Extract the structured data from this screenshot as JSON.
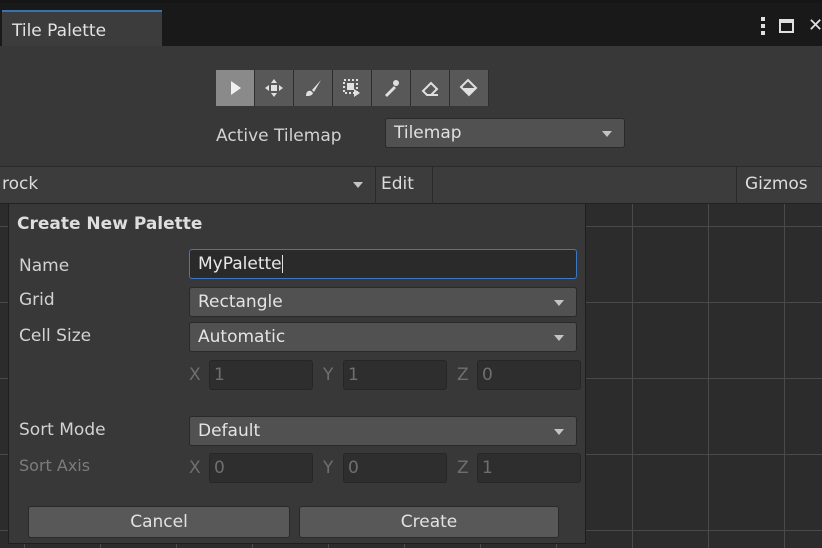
{
  "window": {
    "tab_title": "Tile Palette"
  },
  "toolbar": {
    "tools": [
      {
        "name": "select-tool",
        "icon": "arrow-pointer-icon",
        "active": true
      },
      {
        "name": "move-tool",
        "icon": "move-arrows-icon",
        "active": false
      },
      {
        "name": "paint-tool",
        "icon": "brush-icon",
        "active": false
      },
      {
        "name": "box-fill-tool",
        "icon": "box-fill-icon",
        "active": false
      },
      {
        "name": "picker-tool",
        "icon": "eyedropper-icon",
        "active": false
      },
      {
        "name": "erase-tool",
        "icon": "eraser-icon",
        "active": false
      },
      {
        "name": "fill-tool",
        "icon": "paint-bucket-icon",
        "active": false
      }
    ],
    "active_tilemap_label": "Active Tilemap",
    "active_tilemap_value": "Tilemap"
  },
  "palette_bar": {
    "palette_value": "rock",
    "edit_label": "Edit",
    "gizmos_label": "Gizmos"
  },
  "create_palette": {
    "title": "Create New Palette",
    "name_label": "Name",
    "name_value": "MyPalette",
    "grid_label": "Grid",
    "grid_value": "Rectangle",
    "cell_size_label": "Cell Size",
    "cell_size_value": "Automatic",
    "cell_size_vector": {
      "x_label": "X",
      "x": "1",
      "y_label": "Y",
      "y": "1",
      "z_label": "Z",
      "z": "0"
    },
    "sort_mode_label": "Sort Mode",
    "sort_mode_value": "Default",
    "sort_axis_label": "Sort Axis",
    "sort_axis_vector": {
      "x_label": "X",
      "x": "0",
      "y_label": "Y",
      "y": "0",
      "z_label": "Z",
      "z": "1"
    },
    "cancel_label": "Cancel",
    "create_label": "Create"
  },
  "colors": {
    "accent": "#3b79c7",
    "panel": "#383838",
    "field": "#515151"
  }
}
